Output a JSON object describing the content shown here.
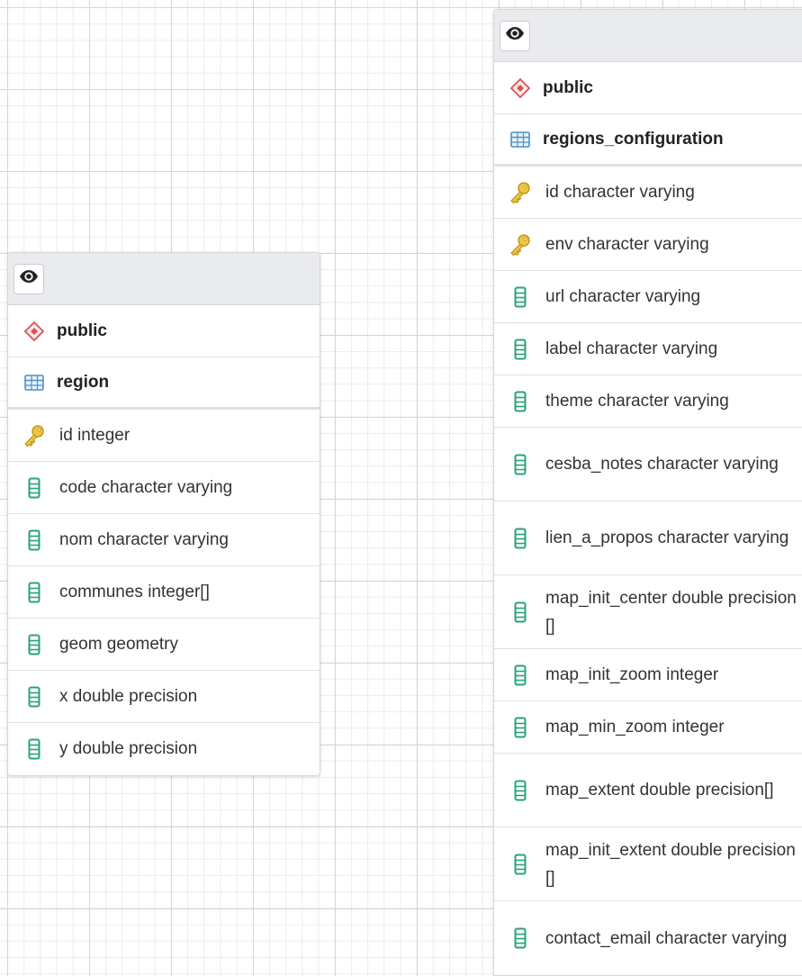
{
  "tables": {
    "left": {
      "schema": "public",
      "name": "region",
      "columns": [
        {
          "icon": "key-icon",
          "label": "id integer"
        },
        {
          "icon": "column-icon",
          "label": "code character varying"
        },
        {
          "icon": "column-icon",
          "label": "nom character varying"
        },
        {
          "icon": "column-icon",
          "label": "communes integer[]"
        },
        {
          "icon": "column-icon",
          "label": "geom geometry"
        },
        {
          "icon": "column-icon",
          "label": "x double precision"
        },
        {
          "icon": "column-icon",
          "label": "y double precision"
        }
      ]
    },
    "right": {
      "schema": "public",
      "name": "regions_configuration",
      "columns": [
        {
          "icon": "key-icon",
          "label": "id character varying"
        },
        {
          "icon": "key-icon",
          "label": "env character varying"
        },
        {
          "icon": "column-icon",
          "label": "url character varying"
        },
        {
          "icon": "column-icon",
          "label": "label character varying"
        },
        {
          "icon": "column-icon",
          "label": "theme character varying"
        },
        {
          "icon": "column-icon",
          "label": "cesba_notes character varying"
        },
        {
          "icon": "column-icon",
          "label": "lien_a_propos character varying"
        },
        {
          "icon": "column-icon",
          "label": "map_init_center double precision[]"
        },
        {
          "icon": "column-icon",
          "label": "map_init_zoom integer"
        },
        {
          "icon": "column-icon",
          "label": "map_min_zoom integer"
        },
        {
          "icon": "column-icon",
          "label": "map_extent double precision[]"
        },
        {
          "icon": "column-icon",
          "label": "map_init_extent double precision[]"
        },
        {
          "icon": "column-icon",
          "label": "contact_email character varying"
        }
      ]
    }
  },
  "colors": {
    "schema_icon": "#d9534f",
    "table_icon": "#4a90c9",
    "key_icon": "#e3b62b",
    "column_icon": "#2aa27c"
  }
}
